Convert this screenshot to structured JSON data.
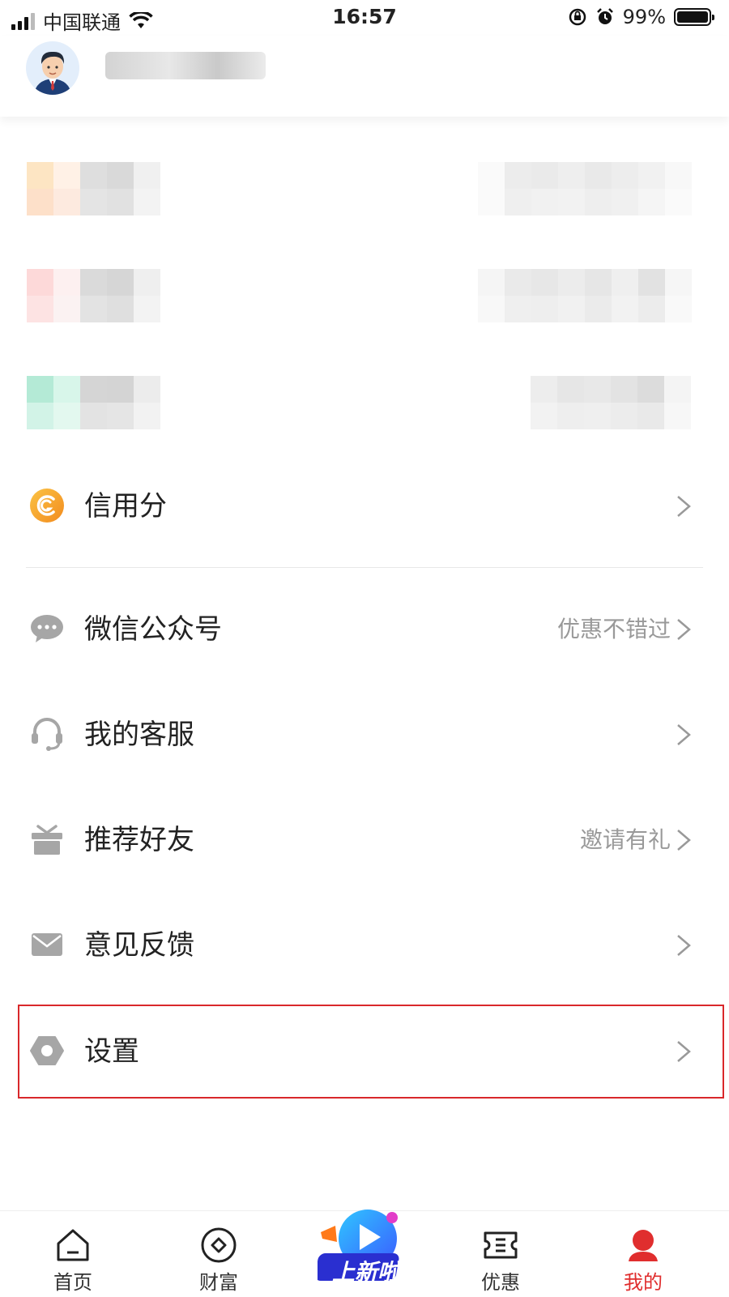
{
  "status_bar": {
    "carrier": "中国联通",
    "time": "16:57",
    "battery_text": "99%",
    "battery_level": 0.99
  },
  "menu": {
    "credit_label": "信用分",
    "wechat_label": "微信公众号",
    "wechat_hint": "优惠不错过",
    "service_label": "我的客服",
    "recommend_label": "推荐好友",
    "recommend_hint": "邀请有礼",
    "feedback_label": "意见反馈",
    "settings_label": "设置"
  },
  "tabs": {
    "home": "首页",
    "wealth": "财富",
    "promo_badge": "上新啦",
    "discount": "优惠",
    "mine": "我的"
  },
  "colors": {
    "accent": "#e02e2e",
    "highlight_border": "#d9282b",
    "credit_icon": "#f5a623",
    "icon_gray": "#a6a6a6"
  },
  "icons": [
    "signal-icon",
    "wifi-icon",
    "rotation-lock-icon",
    "alarm-icon",
    "battery-icon",
    "credit-icon",
    "wechat-icon",
    "headset-icon",
    "gift-icon",
    "mail-icon",
    "settings-icon",
    "chevron-right-icon",
    "home-icon",
    "wealth-icon",
    "discount-icon",
    "mine-icon"
  ]
}
